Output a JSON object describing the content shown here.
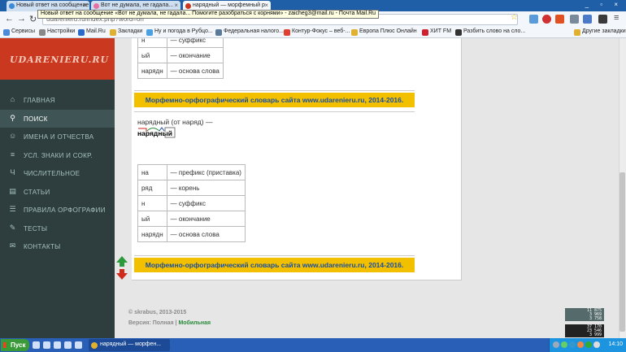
{
  "browser": {
    "tabs": [
      {
        "title": "Новый ответ на сообщение",
        "active": false
      },
      {
        "title": "Вот не думала, не гадала...",
        "active": false
      },
      {
        "title": "нарядный — морфемный р",
        "active": true
      }
    ],
    "url": "udarenieru.ru/index.php?word=on",
    "tooltip": "Новый ответ на сообщение «Вот не думала, не гадала... Помогите разобраться с корнями» - zaicheg3@mail.ru - Почта Mail.Ru"
  },
  "bookmarks": {
    "items": [
      "Сервисы",
      "Настройки",
      "Mail.Ru",
      "Закладки",
      "Ну и погода в Рубцо...",
      "Федеральная налого...",
      "Контур-Фокус – веб-...",
      "Европа Плюс Онлайн",
      "ХИТ FM",
      "Разбить слово на сло..."
    ],
    "other": "Другие закладки"
  },
  "site": {
    "logo": "UDARENIERU.RU",
    "menu": [
      {
        "label": "Главная",
        "icon": "home-icon",
        "glyph": "⌂",
        "active": false
      },
      {
        "label": "Поиск",
        "icon": "search-icon",
        "glyph": "⚲",
        "active": true
      },
      {
        "label": "Имена и отчества",
        "icon": "people-icon",
        "glyph": "☺",
        "active": false
      },
      {
        "label": "Усл. знаки и сокр.",
        "icon": "signs-icon",
        "glyph": "≡",
        "active": false
      },
      {
        "label": "Числительное",
        "icon": "numeral-icon",
        "glyph": "Ч",
        "active": false
      },
      {
        "label": "Статьи",
        "icon": "articles-icon",
        "glyph": "▤",
        "active": false
      },
      {
        "label": "Правила орфографии",
        "icon": "rules-icon",
        "glyph": "☰",
        "active": false
      },
      {
        "label": "Тесты",
        "icon": "tests-icon",
        "glyph": "✎",
        "active": false
      },
      {
        "label": "Контакты",
        "icon": "contacts-icon",
        "glyph": "✉",
        "active": false
      }
    ],
    "first_table": [
      {
        "part": "н",
        "desc": "— суффикс"
      },
      {
        "part": "ый",
        "desc": "— окончание"
      },
      {
        "part": "нарядн",
        "desc": "— основа слова"
      }
    ],
    "banner": "Морфемно-орфографический словарь сайта www.udarenieru.ru, 2014-2016.",
    "word_title": "нарядный (от наряд) —",
    "morph_word": {
      "prefix": "на",
      "root": "ряд",
      "suffix": "н",
      "ending": "ый"
    },
    "second_table": [
      {
        "part": "на",
        "desc": "— префикс (приставка)"
      },
      {
        "part": "ряд",
        "desc": "— корень"
      },
      {
        "part": "н",
        "desc": "— суффикс"
      },
      {
        "part": "ый",
        "desc": "— окончание"
      },
      {
        "part": "нарядн",
        "desc": "— основа слова"
      }
    ],
    "footer_copyright": "© skrabus, 2013-2015",
    "footer_version_label": "Версия: Полная |",
    "footer_version_mobile": "Мобильная",
    "counter1": [
      "11 875",
      "3 969",
      "3 758"
    ],
    "counter2": [
      "37 170",
      "23 546",
      "3 999"
    ]
  },
  "taskbar": {
    "start": "Пуск",
    "task": "нарядный — морфен...",
    "clock": "14:10"
  }
}
